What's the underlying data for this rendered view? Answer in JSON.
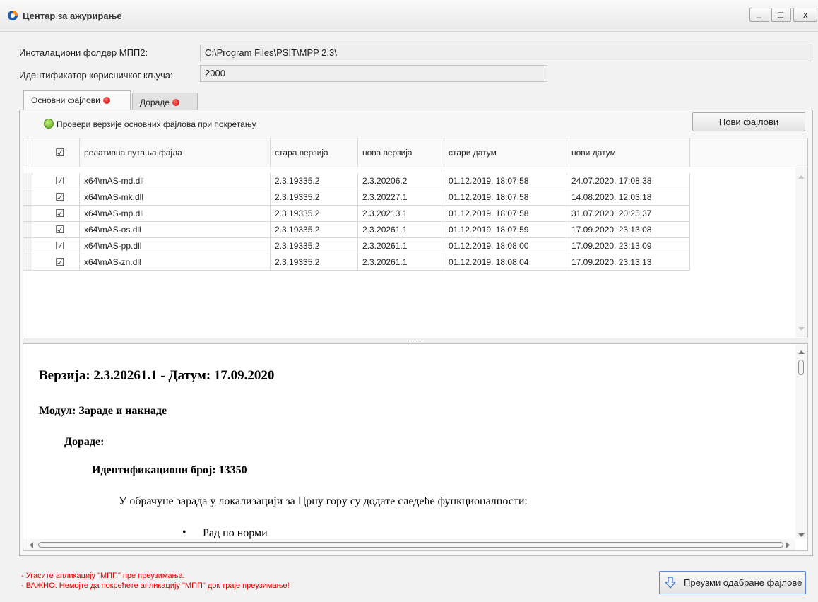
{
  "window": {
    "title": "Центар за ажурирање",
    "minimize_glyph": "_",
    "maximize_glyph": "□",
    "close_glyph": "x"
  },
  "form": {
    "install_folder_label": "Инсталациони фолдер МПП2:",
    "install_folder_value": "C:\\Program Files\\PSIT\\MPP 2.3\\",
    "user_key_label": "Идентификатор корисничког кључа:",
    "user_key_value": "2000"
  },
  "tabs": [
    {
      "label": "Основни фајлови",
      "active": true
    },
    {
      "label": "Дораде",
      "active": false
    }
  ],
  "check_option_label": "Провери верзије основних фајлова при покретању",
  "new_files_button": "Нови фајлови",
  "grid": {
    "header_check": "☑",
    "columns": [
      "релативна путања фајла",
      "стара верзија",
      "нова верзија",
      "стари датум",
      "нови датум"
    ],
    "rows": [
      {
        "checked": "☑",
        "path": "x64\\mAS-md.dll",
        "old_version": "2.3.19335.2",
        "new_version": "2.3.20206.2",
        "old_date": "01.12.2019. 18:07:58",
        "new_date": "24.07.2020. 17:08:38"
      },
      {
        "checked": "☑",
        "path": "x64\\mAS-mk.dll",
        "old_version": "2.3.19335.2",
        "new_version": "2.3.20227.1",
        "old_date": "01.12.2019. 18:07:58",
        "new_date": "14.08.2020. 12:03:18"
      },
      {
        "checked": "☑",
        "path": "x64\\mAS-mp.dll",
        "old_version": "2.3.19335.2",
        "new_version": "2.3.20213.1",
        "old_date": "01.12.2019. 18:07:58",
        "new_date": "31.07.2020. 20:25:37"
      },
      {
        "checked": "☑",
        "path": "x64\\mAS-os.dll",
        "old_version": "2.3.19335.2",
        "new_version": "2.3.20261.1",
        "old_date": "01.12.2019. 18:07:59",
        "new_date": "17.09.2020. 23:13:08"
      },
      {
        "checked": "☑",
        "path": "x64\\mAS-pp.dll",
        "old_version": "2.3.19335.2",
        "new_version": "2.3.20261.1",
        "old_date": "01.12.2019. 18:08:00",
        "new_date": "17.09.2020. 23:13:09"
      },
      {
        "checked": "☑",
        "path": "x64\\mAS-zn.dll",
        "old_version": "2.3.19335.2",
        "new_version": "2.3.20261.1",
        "old_date": "01.12.2019. 18:08:04",
        "new_date": "17.09.2020. 23:13:13"
      }
    ]
  },
  "changelog": {
    "version_line": "Верзија: 2.3.20261.1 - Датум: 17.09.2020",
    "module_line": "Модул: Зараде и накнаде",
    "section_line": "Дораде:",
    "id_line": "Идентификациони број: 13350",
    "description": "У обрачуне зарада у локализацији за Црну гору су додате следеће функционалности:",
    "bullet": "Рад по норми",
    "bullet_glyph": "•"
  },
  "warnings": [
    "- Угасите апликацију \"МПП\" пре преузимања.",
    "- ВАЖНО: Немојте да покрећете апликацију \"МПП\" док траје преузимање!"
  ],
  "download_button": "Преузми одабране фајлове",
  "colors": {
    "warning": "#e10000",
    "status_dot": "#d40000",
    "check_ok": "#5aa218"
  }
}
